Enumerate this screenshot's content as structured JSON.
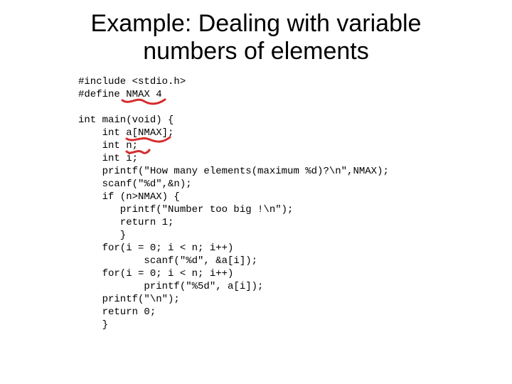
{
  "title_line1": "Example: Dealing with variable",
  "title_line2": "numbers of elements",
  "code_lines": [
    "#include <stdio.h>",
    "#define NMAX 4",
    "",
    "int main(void) {",
    "    int a[NMAX];",
    "    int n;",
    "    int i;",
    "    printf(\"How many elements(maximum %d)?\\n\",NMAX);",
    "    scanf(\"%d\",&n);",
    "    if (n>NMAX) {",
    "       printf(\"Number too big !\\n\");",
    "       return 1;",
    "       }",
    "    for(i = 0; i < n; i++)",
    "           scanf(\"%d\", &a[i]);",
    "    for(i = 0; i < n; i++)",
    "           printf(\"%5d\", a[i]);",
    "    printf(\"\\n\");",
    "    return 0;",
    "    }"
  ],
  "annotations": {
    "underline1_target": "NMAX 4",
    "underline2_target": "a[NMAX]",
    "underline3_target": "n;",
    "color": "#d62d2d"
  }
}
